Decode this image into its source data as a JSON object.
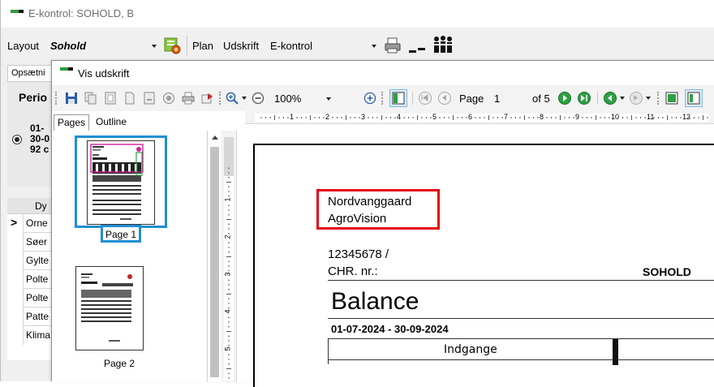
{
  "main_window": {
    "title": "E-kontrol: SOHOLD, B",
    "layout_label": "Layout",
    "layout_value": "Sohold",
    "plan_label": "Plan",
    "udskrift_label": "Udskrift",
    "udskrift_value": "E-kontrol"
  },
  "background_panel": {
    "tab_label": "Opsætni",
    "period_label": "Perio",
    "period_text": [
      "01-",
      "30-0",
      "92 c"
    ],
    "grid_header": "Dy",
    "grid_rows": [
      "Orne",
      "Søer",
      "Gylte",
      "Polte",
      "Polte",
      "Patte",
      "Klima"
    ],
    "current_row_marker": ">"
  },
  "preview_window": {
    "title": "Vis udskrift",
    "zoom_value": "100%",
    "page_label": "Page",
    "page_value": "1",
    "of_label": "of 5",
    "tabs": [
      "Pages",
      "Outline"
    ],
    "thumbnail_labels": [
      "Page 1",
      "Page 2"
    ]
  },
  "ruler": {
    "h_numbers": [
      "1",
      "2",
      "3",
      "4",
      "5",
      "6",
      "7",
      "8",
      "9",
      "10",
      "11",
      "12"
    ],
    "v_numbers": [
      "1",
      "2",
      "3",
      "4",
      "5"
    ]
  },
  "document": {
    "farm_name": "Nordvanggaard",
    "company": "AgroVision",
    "chr_number": "12345678 /",
    "chr_label": "CHR. nr.:",
    "herd_code": "SOHOLD",
    "heading": "Balance",
    "date_range": "01-07-2024 - 30-09-2024",
    "table_header": "Indgange"
  },
  "colors": {
    "highlight_red": "#e30613",
    "highlight_blue": "#1f8fd6",
    "thumb_highlight_magenta": "#d0219b",
    "nav_green": "#2ea043"
  }
}
